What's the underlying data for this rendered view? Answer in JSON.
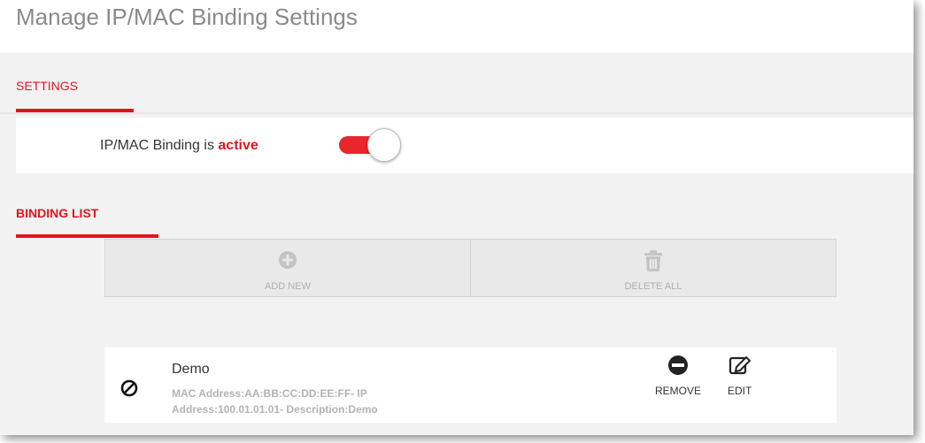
{
  "page": {
    "title": "Manage IP/MAC Binding Settings"
  },
  "settings": {
    "section_label": "SETTINGS",
    "status_prefix": "IP/MAC Binding is",
    "status_value": "active",
    "toggle_on": true
  },
  "binding_list": {
    "section_label": "BINDING LIST",
    "actions": {
      "add_new": {
        "label": "ADD NEW",
        "icon": "plus-circle-icon"
      },
      "delete_all": {
        "label": "DELETE ALL",
        "icon": "trash-icon"
      }
    },
    "entries": [
      {
        "name": "Demo",
        "detail_line1": "MAC Address:AA:BB:CC:DD:EE:FF- IP",
        "detail_line2": "Address:100.01.01.01- Description:Demo",
        "status_icon": "block-icon",
        "remove_label": "REMOVE",
        "edit_label": "EDIT"
      }
    ]
  },
  "colors": {
    "accent": "#e0161e",
    "toggle": "#e8262c",
    "muted": "#b0b0b0"
  }
}
